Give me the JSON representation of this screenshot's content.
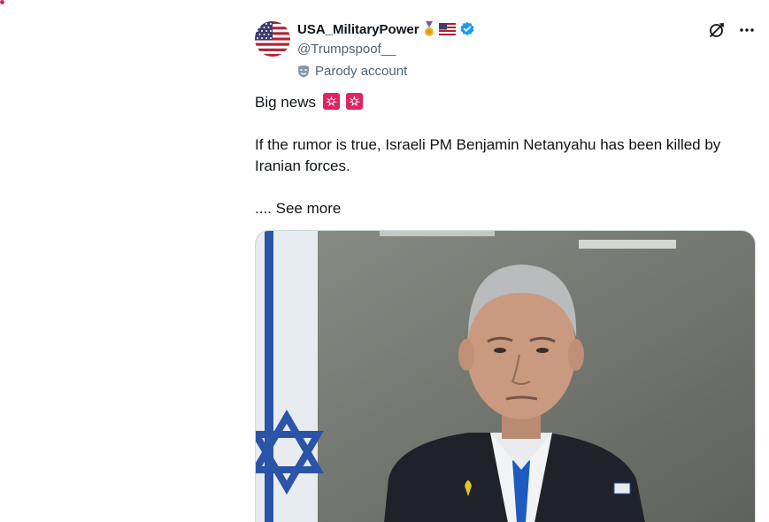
{
  "account": {
    "display_name": "USA_MilitaryPower",
    "handle": "@Trumpspoof__",
    "parody_label": "Parody account",
    "verified_color": "#1d9bf0"
  },
  "icons": {
    "grok": "grok-icon",
    "more": "more-icon",
    "medal": "medal-icon",
    "flag": "us-flag-icon",
    "verified": "verified-badge-icon",
    "parody": "parody-mask-icon",
    "siren": "police-light-icon"
  },
  "tweet": {
    "line1": "Big news",
    "line2": "If the rumor is true, Israeli PM Benjamin Netanyahu has been killed by Iranian forces.",
    "see_more": ".... See more"
  },
  "colors": {
    "text": "#0f1419",
    "secondary": "#536471",
    "siren_red": "#e0245e"
  }
}
